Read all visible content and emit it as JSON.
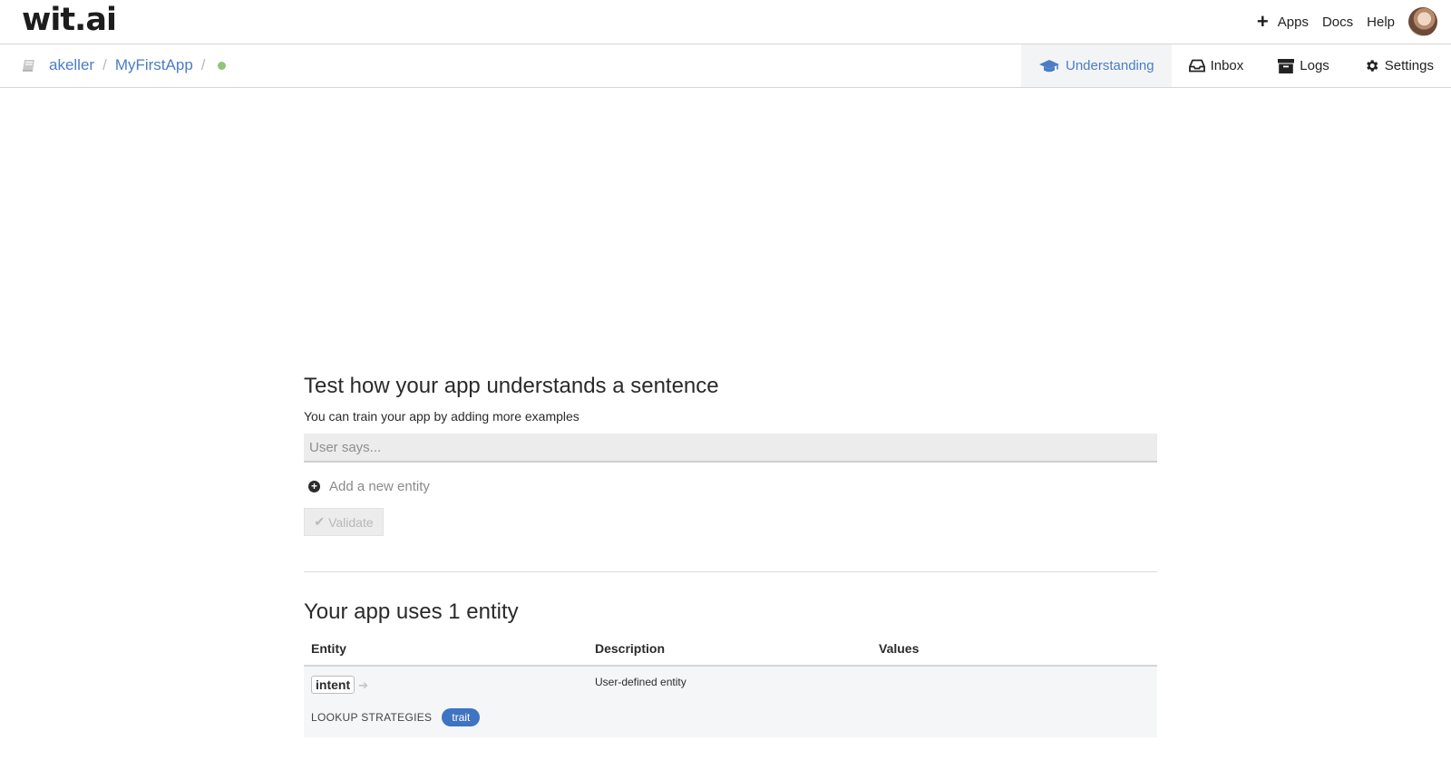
{
  "header": {
    "logo": "wit.ai",
    "nav": [
      {
        "label": "Apps"
      },
      {
        "label": "Docs"
      },
      {
        "label": "Help"
      }
    ]
  },
  "breadcrumb": {
    "user": "akeller",
    "app": "MyFirstApp",
    "status_color": "#8fc47b"
  },
  "tabs": [
    {
      "label": "Understanding",
      "icon": "graduation-cap-icon",
      "active": true
    },
    {
      "label": "Inbox",
      "icon": "inbox-icon",
      "active": false
    },
    {
      "label": "Logs",
      "icon": "archive-icon",
      "active": false
    },
    {
      "label": "Settings",
      "icon": "gear-icon",
      "active": false
    }
  ],
  "test": {
    "title": "Test how your app understands a sentence",
    "subtitle": "You can train your app by adding more examples",
    "input_placeholder": "User says...",
    "add_entity_label": "Add a new entity",
    "validate_label": "Validate"
  },
  "entities": {
    "title": "Your app uses 1 entity",
    "columns": [
      "Entity",
      "Description",
      "Values"
    ],
    "rows": [
      {
        "name": "intent",
        "description": "User-defined entity",
        "values": "",
        "lookup_label": "LOOKUP STRATEGIES",
        "strategy": "trait"
      }
    ]
  },
  "colors": {
    "accent": "#4a7dc4",
    "trait_badge": "#3f73c3",
    "status_dot": "#8fc47b"
  }
}
